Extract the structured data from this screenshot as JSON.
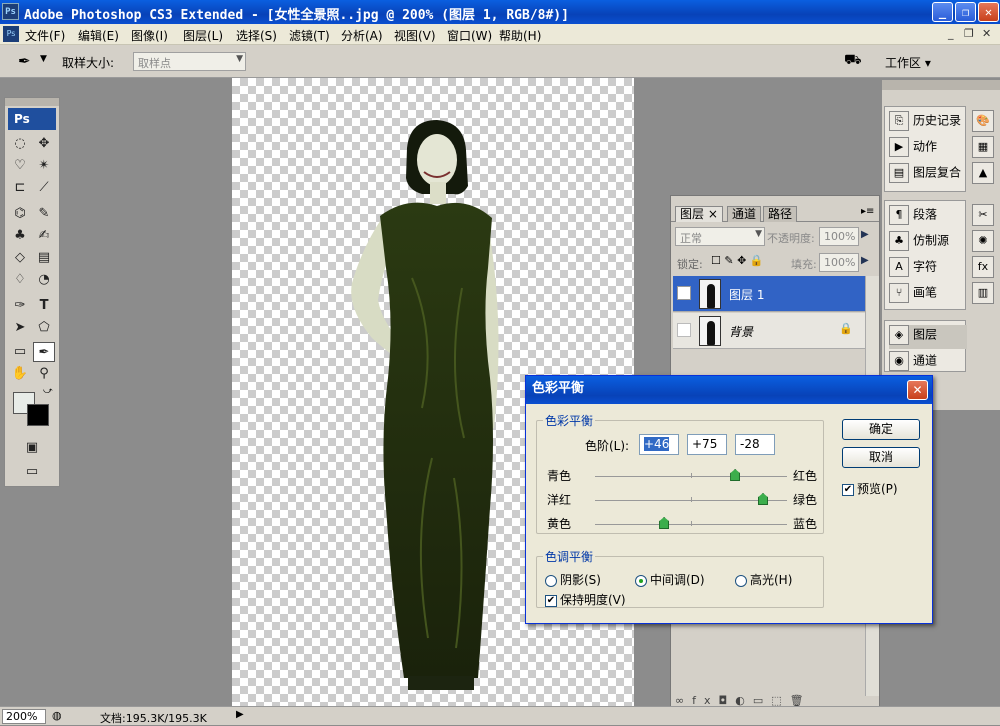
{
  "window": {
    "app_icon": "Ps",
    "title": "Adobe Photoshop CS3 Extended - [女性全景照..jpg @ 200% (图层 1, RGB/8#)]",
    "minimize": "_",
    "maximize": "❐",
    "close": "✕"
  },
  "menu": {
    "items": [
      "文件(F)",
      "编辑(E)",
      "图像(I)",
      "图层(L)",
      "选择(S)",
      "滤镜(T)",
      "分析(A)",
      "视图(V)",
      "窗口(W)",
      "帮助(H)"
    ],
    "doc_minimize": "_",
    "doc_restore": "❐",
    "doc_close": "✕"
  },
  "options": {
    "sample_size_label": "取样大小:",
    "sample_size_value": "取样点",
    "workspace_label": "工作区 ▾"
  },
  "status": {
    "zoom": "200%",
    "doc_info": "文档:195.3K/195.3K"
  },
  "layers_panel": {
    "tabs": [
      "图层",
      "通道",
      "路径"
    ],
    "blend_mode": "正常",
    "opacity_label": "不透明度:",
    "opacity_value": "100%",
    "lock_label": "锁定:",
    "fill_label": "填充:",
    "fill_value": "100%",
    "layers": [
      {
        "name": "图层 1",
        "selected": true,
        "visible": true
      },
      {
        "name": "背景",
        "selected": false,
        "visible": false,
        "locked": true
      }
    ]
  },
  "dock": {
    "group1": [
      "历史记录",
      "动作",
      "图层复合"
    ],
    "group2": [
      "段落",
      "仿制源",
      "字符",
      "画笔"
    ],
    "group3": [
      "图层",
      "通道"
    ]
  },
  "dialog": {
    "title": "色彩平衡",
    "section_balance": "色彩平衡",
    "levels_label": "色阶(L):",
    "levels": [
      "+46",
      "+75",
      "-28"
    ],
    "sliders": [
      {
        "left": "青色",
        "right": "红色",
        "value": 46
      },
      {
        "left": "洋红",
        "right": "绿色",
        "value": 75
      },
      {
        "left": "黄色",
        "right": "蓝色",
        "value": -28
      }
    ],
    "section_tone": "色调平衡",
    "tones": [
      "阴影(S)",
      "中间调(D)",
      "高光(H)"
    ],
    "tone_selected": "中间调(D)",
    "preserve_luminosity": "保持明度(V)",
    "ok": "确定",
    "cancel": "取消",
    "preview": "预览(P)"
  },
  "colors": {
    "accent": "#0842b8",
    "slider_knob": "#3cae4c"
  }
}
